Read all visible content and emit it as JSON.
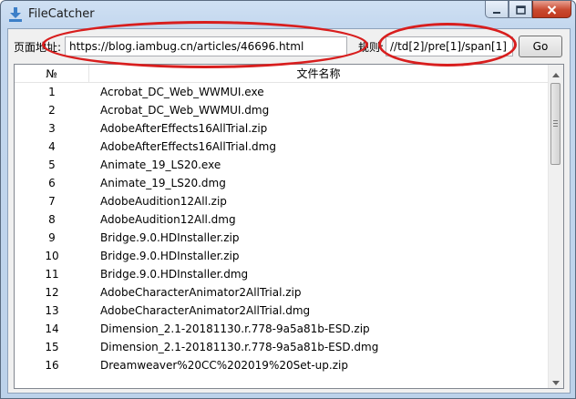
{
  "window": {
    "title": "FileCatcher"
  },
  "toolbar": {
    "url_label": "页面地址:",
    "url_value": "https://blog.iambug.cn/articles/46696.html",
    "rule_label": "规则:",
    "rule_value": "//td[2]/pre[1]/span[1]",
    "go_label": "Go"
  },
  "table": {
    "columns": [
      "№",
      "文件名称"
    ],
    "rows": [
      {
        "no": "1",
        "name": "Acrobat_DC_Web_WWMUI.exe"
      },
      {
        "no": "2",
        "name": "Acrobat_DC_Web_WWMUI.dmg"
      },
      {
        "no": "3",
        "name": "AdobeAfterEffects16AllTrial.zip"
      },
      {
        "no": "4",
        "name": "AdobeAfterEffects16AllTrial.dmg"
      },
      {
        "no": "5",
        "name": "Animate_19_LS20.exe"
      },
      {
        "no": "6",
        "name": "Animate_19_LS20.dmg"
      },
      {
        "no": "7",
        "name": "AdobeAudition12All.zip"
      },
      {
        "no": "8",
        "name": "AdobeAudition12All.dmg"
      },
      {
        "no": "9",
        "name": "Bridge.9.0.HDInstaller.zip"
      },
      {
        "no": "10",
        "name": "Bridge.9.0.HDInstaller.zip"
      },
      {
        "no": "11",
        "name": "Bridge.9.0.HDInstaller.dmg"
      },
      {
        "no": "12",
        "name": "AdobeCharacterAnimator2AllTrial.zip"
      },
      {
        "no": "13",
        "name": "AdobeCharacterAnimator2AllTrial.dmg"
      },
      {
        "no": "14",
        "name": "Dimension_2.1-20181130.r.778-9a5a81b-ESD.zip"
      },
      {
        "no": "15",
        "name": "Dimension_2.1-20181130.r.778-9a5a81b-ESD.dmg"
      },
      {
        "no": "16",
        "name": "Dreamweaver%20CC%202019%20Set-up.zip"
      }
    ]
  },
  "colors": {
    "annotation": "#d81e1e",
    "accent": "#3c7fc8"
  },
  "icons": [
    "download-icon",
    "minimize-icon",
    "maximize-icon",
    "close-icon",
    "scroll-up-icon",
    "scroll-down-icon"
  ]
}
